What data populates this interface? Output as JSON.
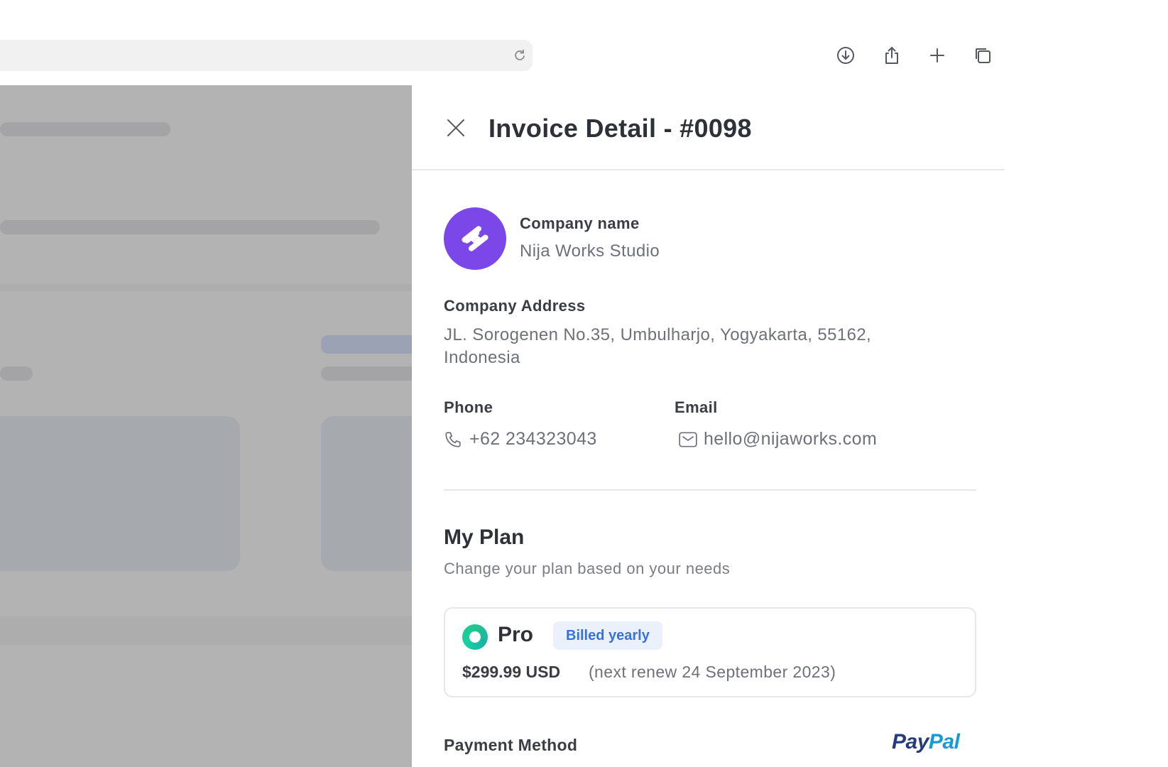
{
  "browser": {
    "icons": [
      "reload-icon",
      "download-icon",
      "share-icon",
      "new-tab-icon",
      "tabs-icon"
    ]
  },
  "drawer": {
    "title": "Invoice Detail - #0098",
    "close_icon": "close-icon"
  },
  "company": {
    "logo_icon": "company-logo-icon",
    "logo_color": "#7c47e8",
    "name_label": "Company name",
    "name_value": "Nija Works Studio",
    "address_label": "Company Address",
    "address_value": "JL. Sorogenen No.35, Umbulharjo, Yogyakarta, 55162, Indonesia",
    "phone_label": "Phone",
    "phone_value": "+62 234323043",
    "email_label": "Email",
    "email_value": "hello@nijaworks.com"
  },
  "plan": {
    "heading": "My Plan",
    "subtitle": "Change your plan based on your needs",
    "name": "Pro",
    "badge": "Billed yearly",
    "price": "$299.99 USD",
    "renew": "(next renew 24 September 2023)",
    "accent_color": "#23c48f",
    "badge_color": "#3a71d6"
  },
  "payment": {
    "label": "Payment Method",
    "provider_pay": "Pay",
    "provider_pal": "Pal"
  }
}
